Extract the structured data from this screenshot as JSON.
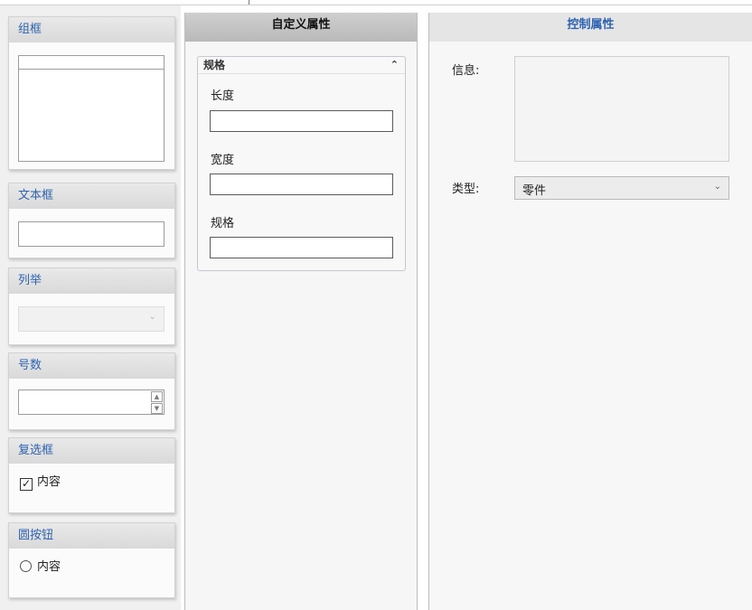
{
  "toolbox": {
    "group_box": {
      "title": "组框"
    },
    "text_box": {
      "title": "文本框"
    },
    "enum": {
      "title": "列举",
      "arrow_glyph": "⌄"
    },
    "number": {
      "title": "号数",
      "up_glyph": "▲",
      "down_glyph": "▼"
    },
    "checkbox": {
      "title": "复选框",
      "item_label": "内容",
      "checked_glyph": "✓",
      "checked": true
    },
    "radio": {
      "title": "圆按钮",
      "item_label": "内容"
    }
  },
  "custom_properties": {
    "title": "自定义属性",
    "group": {
      "title": "规格",
      "collapse_glyph": "⌃",
      "fields": [
        {
          "label": "长度",
          "value": ""
        },
        {
          "label": "宽度",
          "value": ""
        },
        {
          "label": "规格",
          "value": ""
        }
      ]
    }
  },
  "control_properties": {
    "title": "控制属性",
    "info_label": "信息:",
    "info_value": "",
    "type_label": "类型:",
    "type_value": "零件",
    "type_arrow_glyph": "⌄"
  },
  "colors": {
    "header_text_blue": "#2e63b0",
    "header_gray": "#d9d9d9",
    "panel_bg": "#f6f6f6"
  }
}
